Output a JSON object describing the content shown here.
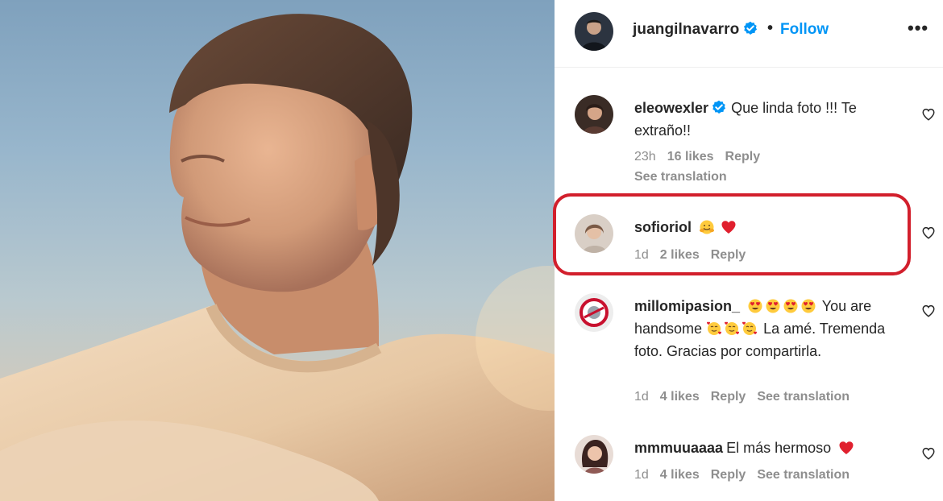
{
  "post": {
    "username": "juangilnavarro",
    "follow_label": "Follow",
    "separator": "•",
    "more_label": "•••"
  },
  "comments": [
    {
      "username": "eleowexler",
      "text": "Que linda foto !!! Te extraño!!",
      "time": "23h",
      "likes": "16 likes",
      "reply": "Reply",
      "see_translation": "See translation"
    },
    {
      "username": "sofioriol",
      "text": "",
      "time": "1d",
      "likes": "2 likes",
      "reply": "Reply"
    },
    {
      "username": "millomipasion_",
      "text_a": "You are handsome",
      "text_b": "La amé. Tremenda foto. Gracias por compartirla.",
      "time": "1d",
      "likes": "4 likes",
      "reply": "Reply",
      "see_translation": "See translation"
    },
    {
      "username": "mmmuuaaaa",
      "text": "El más hermoso",
      "time": "1d",
      "likes": "4 likes",
      "reply": "Reply",
      "see_translation": "See translation"
    }
  ],
  "icons": {
    "verified": "verified-badge-icon",
    "heart": "heart-outline-icon",
    "more": "more-options-icon"
  },
  "colors": {
    "accent": "#0095f6",
    "highlight": "#d21f2c",
    "muted": "#8e8e8e"
  }
}
